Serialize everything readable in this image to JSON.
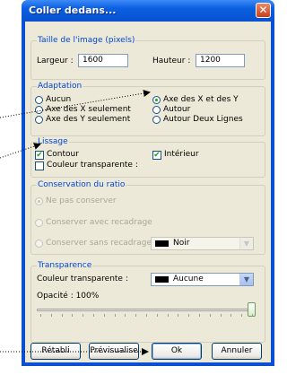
{
  "window": {
    "title": "Coller dedans...",
    "close_glyph": "✕"
  },
  "image_size": {
    "legend": "Taille de l'image (pixels)",
    "width_label": "Largeur :",
    "width_value": "1600",
    "height_label": "Hauteur :",
    "height_value": "1200"
  },
  "adaptation": {
    "legend": "Adaptation",
    "options": [
      {
        "label": "Aucun",
        "checked": false
      },
      {
        "label": "Axe des X seulement",
        "checked": false
      },
      {
        "label": "Axe des Y seulement",
        "checked": false
      },
      {
        "label": "Axe des X et des Y",
        "checked": true
      },
      {
        "label": "Autour",
        "checked": false
      },
      {
        "label": "Autour Deux Lignes",
        "checked": false
      }
    ]
  },
  "smoothing": {
    "legend": "Lissage",
    "contour_label": "Contour",
    "contour_checked": true,
    "interior_label": "Intérieur",
    "interior_checked": true,
    "transparent_label": "Couleur transparente :",
    "transparent_checked": false
  },
  "ratio": {
    "legend": "Conservation du ratio",
    "options": [
      {
        "label": "Ne pas conserver",
        "checked": true
      },
      {
        "label": "Conserver avec recadrage",
        "checked": false
      },
      {
        "label": "Conserver sans recadrage",
        "checked": false
      }
    ],
    "color_value": "Noir"
  },
  "transparency": {
    "legend": "Transparence",
    "color_label": "Couleur transparente :",
    "color_value": "Aucune",
    "opacity_label": "Opacité : 100%",
    "opacity_fraction": 1.0
  },
  "buttons": {
    "reset": "Rétabli",
    "preview": "Prévisualise",
    "ok": "Ok",
    "cancel": "Annuler"
  },
  "icons": {
    "dropdown": "chevron-down-icon",
    "close": "close-icon"
  },
  "colors": {
    "title_bar": "#0a5fe0",
    "legend_text": "#0046d5",
    "dialog_bg": "#ece9d8"
  }
}
